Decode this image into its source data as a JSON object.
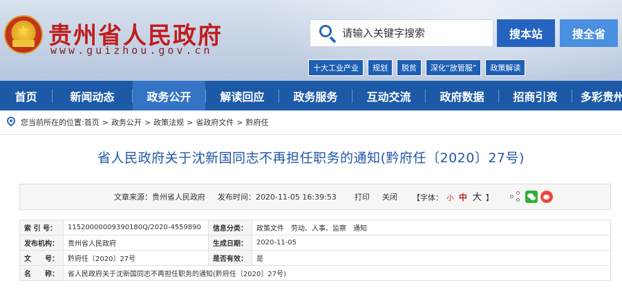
{
  "header": {
    "site_title": "贵州省人民政府",
    "site_url": "www.guizhou.gov.cn",
    "search": {
      "placeholder": "请输入关键字搜索"
    },
    "btn_site": "搜本站",
    "btn_province": "搜全省",
    "hot_tags": [
      "十大工业产业",
      "规划",
      "脱贫",
      "深化“放管服”",
      "政策解读"
    ]
  },
  "nav": {
    "items": [
      "首页",
      "新闻动态",
      "政务公开",
      "解读回应",
      "政务服务",
      "互动交流",
      "政府数据",
      "招商引资",
      "多彩贵州"
    ],
    "active_index": 2
  },
  "breadcrumb": {
    "prefix": "您当前所在的位置:",
    "items": [
      "首页",
      "政务公开",
      "政策法规",
      "省政府文件",
      "黔府任"
    ]
  },
  "article": {
    "title": "省人民政府关于沈新国同志不再担任职务的通知(黔府任〔2020〕27号)",
    "source": "文章来源：贵州省人民政府",
    "date": "发布时间：2020-11-05 16:39:53",
    "print": "打印",
    "close": "关闭",
    "font_label_open": "【字体：",
    "font_small": "小",
    "font_mid": "中",
    "font_big": "大",
    "font_label_close": "】"
  },
  "info": {
    "rows": [
      {
        "k1": "索 引 号：",
        "v1": "11520000009390180Q/2020-4559890",
        "k2": "信息分类：",
        "v2": "政策文件　劳动、人事、监察　通知"
      },
      {
        "k1": "发布机构：",
        "v1": "贵州省人民政府",
        "k2": "生成日期：",
        "v2": "2020-11-05"
      },
      {
        "k1": "文　　号：",
        "v1": "黔府任〔2020〕27号",
        "k2": "是否有效：",
        "v2": "是"
      },
      {
        "k1": "名　　称：",
        "v1": "省人民政府关于沈新国同志不再担任职务的通知(黔府任〔2020〕27号)",
        "k2": "",
        "v2": ""
      }
    ]
  },
  "colors": {
    "nav_bg": "#1c5aa8",
    "nav_active": "#3474c5",
    "title_red": "#c01d1d",
    "article_title": "#2157a7"
  }
}
